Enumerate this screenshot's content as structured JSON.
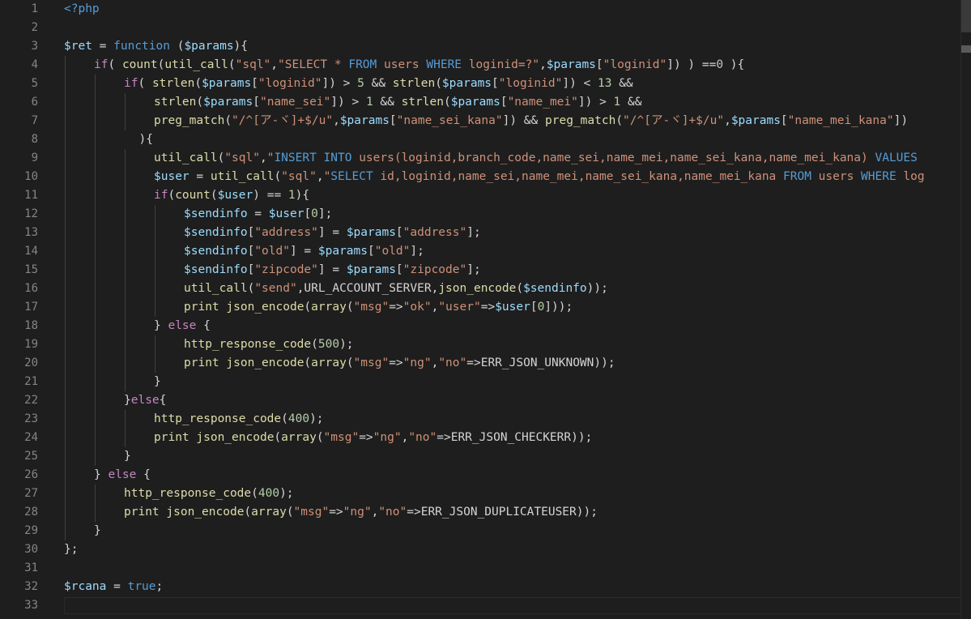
{
  "editor": {
    "language": "php",
    "colors": {
      "background": "#1e1e1e",
      "line_number": "#858585",
      "keyword": "#569cd6",
      "control": "#c586c0",
      "variable": "#9cdcfe",
      "function": "#dcdcaa",
      "string": "#ce9178",
      "number": "#b5cea8",
      "text": "#d4d4d4"
    },
    "lines": [
      {
        "n": "1",
        "indent": 0,
        "tokens": [
          [
            "tag",
            "<?php"
          ]
        ]
      },
      {
        "n": "2",
        "indent": 0,
        "tokens": []
      },
      {
        "n": "3",
        "indent": 0,
        "tokens": [
          [
            "var",
            "$ret"
          ],
          [
            "op",
            " = "
          ],
          [
            "kw",
            "function"
          ],
          [
            "op",
            " ("
          ],
          [
            "var",
            "$params"
          ],
          [
            "op",
            "){"
          ]
        ]
      },
      {
        "n": "4",
        "indent": 1,
        "tokens": [
          [
            "kw2",
            "if"
          ],
          [
            "op",
            "( "
          ],
          [
            "fn",
            "count"
          ],
          [
            "op",
            "("
          ],
          [
            "fn",
            "util_call"
          ],
          [
            "op",
            "("
          ],
          [
            "str",
            "\"sql\""
          ],
          [
            "op",
            ","
          ],
          [
            "str",
            "\"SELECT * "
          ],
          [
            "sqlkw",
            "FROM"
          ],
          [
            "str",
            " users "
          ],
          [
            "sqlkw",
            "WHERE"
          ],
          [
            "str",
            " loginid=?\""
          ],
          [
            "op",
            ","
          ],
          [
            "var",
            "$params"
          ],
          [
            "op",
            "["
          ],
          [
            "str",
            "\"loginid\""
          ],
          [
            "op",
            "]) ) =="
          ],
          [
            "num",
            "0"
          ],
          [
            "op",
            " ){"
          ]
        ]
      },
      {
        "n": "5",
        "indent": 2,
        "tokens": [
          [
            "kw2",
            "if"
          ],
          [
            "op",
            "( "
          ],
          [
            "fn",
            "strlen"
          ],
          [
            "op",
            "("
          ],
          [
            "var",
            "$params"
          ],
          [
            "op",
            "["
          ],
          [
            "str",
            "\"loginid\""
          ],
          [
            "op",
            "]) > "
          ],
          [
            "num",
            "5"
          ],
          [
            "op",
            " && "
          ],
          [
            "fn",
            "strlen"
          ],
          [
            "op",
            "("
          ],
          [
            "var",
            "$params"
          ],
          [
            "op",
            "["
          ],
          [
            "str",
            "\"loginid\""
          ],
          [
            "op",
            "]) < "
          ],
          [
            "num",
            "13"
          ],
          [
            "op",
            " &&"
          ]
        ]
      },
      {
        "n": "6",
        "indent": 3,
        "tokens": [
          [
            "fn",
            "strlen"
          ],
          [
            "op",
            "("
          ],
          [
            "var",
            "$params"
          ],
          [
            "op",
            "["
          ],
          [
            "str",
            "\"name_sei\""
          ],
          [
            "op",
            "]) > "
          ],
          [
            "num",
            "1"
          ],
          [
            "op",
            " && "
          ],
          [
            "fn",
            "strlen"
          ],
          [
            "op",
            "("
          ],
          [
            "var",
            "$params"
          ],
          [
            "op",
            "["
          ],
          [
            "str",
            "\"name_mei\""
          ],
          [
            "op",
            "]) > "
          ],
          [
            "num",
            "1"
          ],
          [
            "op",
            " &&"
          ]
        ]
      },
      {
        "n": "7",
        "indent": 3,
        "tokens": [
          [
            "fn",
            "preg_match"
          ],
          [
            "op",
            "("
          ],
          [
            "str",
            "\"/^[ア-ヾ]+$/u\""
          ],
          [
            "op",
            ","
          ],
          [
            "var",
            "$params"
          ],
          [
            "op",
            "["
          ],
          [
            "str",
            "\"name_sei_kana\""
          ],
          [
            "op",
            "]) && "
          ],
          [
            "fn",
            "preg_match"
          ],
          [
            "op",
            "("
          ],
          [
            "str",
            "\"/^[ア-ヾ]+$/u\""
          ],
          [
            "op",
            ","
          ],
          [
            "var",
            "$params"
          ],
          [
            "op",
            "["
          ],
          [
            "str",
            "\"name_mei_kana\""
          ],
          [
            "op",
            "])"
          ]
        ]
      },
      {
        "n": "8",
        "indent": 2.5,
        "tokens": [
          [
            "op",
            "){"
          ]
        ]
      },
      {
        "n": "9",
        "indent": 3,
        "tokens": [
          [
            "fn",
            "util_call"
          ],
          [
            "op",
            "("
          ],
          [
            "str",
            "\"sql\""
          ],
          [
            "op",
            ","
          ],
          [
            "str",
            "\""
          ],
          [
            "sqlkw",
            "INSERT INTO"
          ],
          [
            "str",
            " users(loginid,branch_code,name_sei,name_mei,name_sei_kana,name_mei_kana) "
          ],
          [
            "sqlkw",
            "VALUES"
          ]
        ]
      },
      {
        "n": "10",
        "indent": 3,
        "tokens": [
          [
            "var",
            "$user"
          ],
          [
            "op",
            " = "
          ],
          [
            "fn",
            "util_call"
          ],
          [
            "op",
            "("
          ],
          [
            "str",
            "\"sql\""
          ],
          [
            "op",
            ","
          ],
          [
            "str",
            "\""
          ],
          [
            "sqlkw",
            "SELECT"
          ],
          [
            "str",
            " id,loginid,name_sei,name_mei,name_sei_kana,name_mei_kana "
          ],
          [
            "sqlkw",
            "FROM"
          ],
          [
            "str",
            " users "
          ],
          [
            "sqlkw",
            "WHERE"
          ],
          [
            "str",
            " log"
          ]
        ]
      },
      {
        "n": "11",
        "indent": 3,
        "tokens": [
          [
            "kw2",
            "if"
          ],
          [
            "op",
            "("
          ],
          [
            "fn",
            "count"
          ],
          [
            "op",
            "("
          ],
          [
            "var",
            "$user"
          ],
          [
            "op",
            ") == "
          ],
          [
            "num",
            "1"
          ],
          [
            "op",
            "){"
          ]
        ]
      },
      {
        "n": "12",
        "indent": 4,
        "tokens": [
          [
            "var",
            "$sendinfo"
          ],
          [
            "op",
            " = "
          ],
          [
            "var",
            "$user"
          ],
          [
            "op",
            "["
          ],
          [
            "num",
            "0"
          ],
          [
            "op",
            "];"
          ]
        ]
      },
      {
        "n": "13",
        "indent": 4,
        "tokens": [
          [
            "var",
            "$sendinfo"
          ],
          [
            "op",
            "["
          ],
          [
            "str",
            "\"address\""
          ],
          [
            "op",
            "] = "
          ],
          [
            "var",
            "$params"
          ],
          [
            "op",
            "["
          ],
          [
            "str",
            "\"address\""
          ],
          [
            "op",
            "];"
          ]
        ]
      },
      {
        "n": "14",
        "indent": 4,
        "tokens": [
          [
            "var",
            "$sendinfo"
          ],
          [
            "op",
            "["
          ],
          [
            "str",
            "\"old\""
          ],
          [
            "op",
            "] = "
          ],
          [
            "var",
            "$params"
          ],
          [
            "op",
            "["
          ],
          [
            "str",
            "\"old\""
          ],
          [
            "op",
            "];"
          ]
        ]
      },
      {
        "n": "15",
        "indent": 4,
        "tokens": [
          [
            "var",
            "$sendinfo"
          ],
          [
            "op",
            "["
          ],
          [
            "str",
            "\"zipcode\""
          ],
          [
            "op",
            "] = "
          ],
          [
            "var",
            "$params"
          ],
          [
            "op",
            "["
          ],
          [
            "str",
            "\"zipcode\""
          ],
          [
            "op",
            "];"
          ]
        ]
      },
      {
        "n": "16",
        "indent": 4,
        "tokens": [
          [
            "fn",
            "util_call"
          ],
          [
            "op",
            "("
          ],
          [
            "str",
            "\"send\""
          ],
          [
            "op",
            ",URL_ACCOUNT_SERVER,"
          ],
          [
            "fn",
            "json_encode"
          ],
          [
            "op",
            "("
          ],
          [
            "var",
            "$sendinfo"
          ],
          [
            "op",
            "));"
          ]
        ]
      },
      {
        "n": "17",
        "indent": 4,
        "tokens": [
          [
            "fn",
            "print"
          ],
          [
            "op",
            " "
          ],
          [
            "fn",
            "json_encode"
          ],
          [
            "op",
            "("
          ],
          [
            "fn",
            "array"
          ],
          [
            "op",
            "("
          ],
          [
            "str",
            "\"msg\""
          ],
          [
            "op",
            "=>"
          ],
          [
            "str",
            "\"ok\""
          ],
          [
            "op",
            ","
          ],
          [
            "str",
            "\"user\""
          ],
          [
            "op",
            "=>"
          ],
          [
            "var",
            "$user"
          ],
          [
            "op",
            "["
          ],
          [
            "num",
            "0"
          ],
          [
            "op",
            "]));"
          ]
        ]
      },
      {
        "n": "18",
        "indent": 3,
        "tokens": [
          [
            "op",
            "} "
          ],
          [
            "kw2",
            "else"
          ],
          [
            "op",
            " {"
          ]
        ]
      },
      {
        "n": "19",
        "indent": 4,
        "tokens": [
          [
            "fn",
            "http_response_code"
          ],
          [
            "op",
            "("
          ],
          [
            "num",
            "500"
          ],
          [
            "op",
            ");"
          ]
        ]
      },
      {
        "n": "20",
        "indent": 4,
        "tokens": [
          [
            "fn",
            "print"
          ],
          [
            "op",
            " "
          ],
          [
            "fn",
            "json_encode"
          ],
          [
            "op",
            "("
          ],
          [
            "fn",
            "array"
          ],
          [
            "op",
            "("
          ],
          [
            "str",
            "\"msg\""
          ],
          [
            "op",
            "=>"
          ],
          [
            "str",
            "\"ng\""
          ],
          [
            "op",
            ","
          ],
          [
            "str",
            "\"no\""
          ],
          [
            "op",
            "=>ERR_JSON_UNKNOWN));"
          ]
        ]
      },
      {
        "n": "21",
        "indent": 3,
        "tokens": [
          [
            "op",
            "}"
          ]
        ]
      },
      {
        "n": "22",
        "indent": 2,
        "tokens": [
          [
            "op",
            "}"
          ],
          [
            "kw2",
            "else"
          ],
          [
            "op",
            "{"
          ]
        ]
      },
      {
        "n": "23",
        "indent": 3,
        "tokens": [
          [
            "fn",
            "http_response_code"
          ],
          [
            "op",
            "("
          ],
          [
            "num",
            "400"
          ],
          [
            "op",
            ");"
          ]
        ]
      },
      {
        "n": "24",
        "indent": 3,
        "tokens": [
          [
            "fn",
            "print"
          ],
          [
            "op",
            " "
          ],
          [
            "fn",
            "json_encode"
          ],
          [
            "op",
            "("
          ],
          [
            "fn",
            "array"
          ],
          [
            "op",
            "("
          ],
          [
            "str",
            "\"msg\""
          ],
          [
            "op",
            "=>"
          ],
          [
            "str",
            "\"ng\""
          ],
          [
            "op",
            ","
          ],
          [
            "str",
            "\"no\""
          ],
          [
            "op",
            "=>ERR_JSON_CHECKERR));"
          ]
        ]
      },
      {
        "n": "25",
        "indent": 2,
        "tokens": [
          [
            "op",
            "}"
          ]
        ]
      },
      {
        "n": "26",
        "indent": 1,
        "tokens": [
          [
            "op",
            "} "
          ],
          [
            "kw2",
            "else"
          ],
          [
            "op",
            " {"
          ]
        ]
      },
      {
        "n": "27",
        "indent": 2,
        "tokens": [
          [
            "fn",
            "http_response_code"
          ],
          [
            "op",
            "("
          ],
          [
            "num",
            "400"
          ],
          [
            "op",
            ");"
          ]
        ]
      },
      {
        "n": "28",
        "indent": 2,
        "tokens": [
          [
            "fn",
            "print"
          ],
          [
            "op",
            " "
          ],
          [
            "fn",
            "json_encode"
          ],
          [
            "op",
            "("
          ],
          [
            "fn",
            "array"
          ],
          [
            "op",
            "("
          ],
          [
            "str",
            "\"msg\""
          ],
          [
            "op",
            "=>"
          ],
          [
            "str",
            "\"ng\""
          ],
          [
            "op",
            ","
          ],
          [
            "str",
            "\"no\""
          ],
          [
            "op",
            "=>ERR_JSON_DUPLICATEUSER));"
          ]
        ]
      },
      {
        "n": "29",
        "indent": 1,
        "tokens": [
          [
            "op",
            "}"
          ]
        ]
      },
      {
        "n": "30",
        "indent": 0,
        "tokens": [
          [
            "op",
            "};"
          ]
        ]
      },
      {
        "n": "31",
        "indent": 0,
        "tokens": []
      },
      {
        "n": "32",
        "indent": 0,
        "tokens": [
          [
            "var",
            "$rcana"
          ],
          [
            "op",
            " = "
          ],
          [
            "kw",
            "true"
          ],
          [
            "op",
            ";"
          ]
        ]
      },
      {
        "n": "33",
        "indent": 0,
        "tokens": []
      }
    ]
  }
}
